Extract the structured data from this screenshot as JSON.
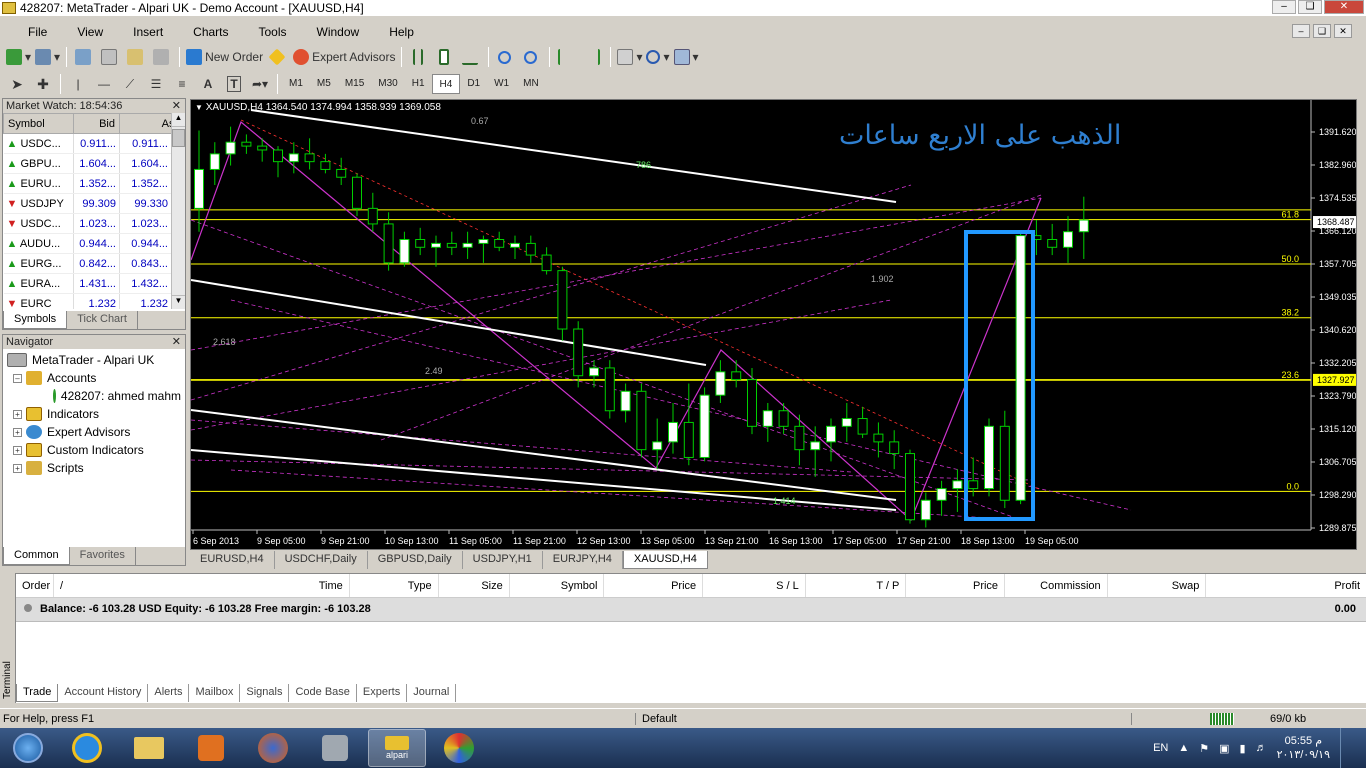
{
  "window": {
    "title": "428207: MetaTrader - Alpari UK - Demo Account - [XAUUSD,H4]"
  },
  "menu": [
    "File",
    "View",
    "Insert",
    "Charts",
    "Tools",
    "Window",
    "Help"
  ],
  "toolbar": {
    "new_order": "New Order",
    "expert_advisors": "Expert Advisors"
  },
  "timeframes": [
    "M1",
    "M5",
    "M15",
    "M30",
    "H1",
    "H4",
    "D1",
    "W1",
    "MN"
  ],
  "active_timeframe": "H4",
  "market_watch": {
    "title": "Market Watch: 18:54:36",
    "columns": [
      "Symbol",
      "Bid",
      "Ask"
    ],
    "rows": [
      {
        "symbol": "USDC...",
        "bid": "0.911...",
        "ask": "0.911...",
        "dir": "up"
      },
      {
        "symbol": "GBPU...",
        "bid": "1.604...",
        "ask": "1.604...",
        "dir": "up"
      },
      {
        "symbol": "EURU...",
        "bid": "1.352...",
        "ask": "1.352...",
        "dir": "up"
      },
      {
        "symbol": "USDJPY",
        "bid": "99.309",
        "ask": "99.330",
        "dir": "down"
      },
      {
        "symbol": "USDC...",
        "bid": "1.023...",
        "ask": "1.023...",
        "dir": "down"
      },
      {
        "symbol": "AUDU...",
        "bid": "0.944...",
        "ask": "0.944...",
        "dir": "up"
      },
      {
        "symbol": "EURG...",
        "bid": "0.842...",
        "ask": "0.843...",
        "dir": "up"
      },
      {
        "symbol": "EURA...",
        "bid": "1.431...",
        "ask": "1.432...",
        "dir": "up"
      },
      {
        "symbol": "EURC",
        "bid": "1.232",
        "ask": "1.232",
        "dir": "down"
      }
    ],
    "tabs": [
      "Symbols",
      "Tick Chart"
    ]
  },
  "navigator": {
    "title": "Navigator",
    "root": "MetaTrader - Alpari UK",
    "accounts": "Accounts",
    "account": "428207: ahmed mahm",
    "items": [
      "Indicators",
      "Expert Advisors",
      "Custom Indicators",
      "Scripts"
    ],
    "tabs": [
      "Common",
      "Favorites"
    ]
  },
  "chart": {
    "header": "XAUUSD,H4  1364.540 1374.994 1358.939 1369.058",
    "annotation": "الذهب على الاربع ساعات",
    "price_axis": [
      "1391.620",
      "1382.960",
      "1374.535",
      "1366.120",
      "1357.705",
      "1349.035",
      "1340.620",
      "1332.205",
      "1323.790",
      "1315.120",
      "1306.705",
      "1298.290",
      "1289.875"
    ],
    "current_price": "1368.487",
    "level_price": "1327.927",
    "fib_labels": [
      "61.8",
      "50.0",
      "38.2",
      "23.6",
      "0.0"
    ],
    "fan_labels": [
      "0.67",
      "786",
      "1.902",
      "2.618",
      "2.49",
      "1.414"
    ],
    "time_axis": [
      "6 Sep 2013",
      "9 Sep 05:00",
      "9 Sep 21:00",
      "10 Sep 13:00",
      "11 Sep 05:00",
      "11 Sep 21:00",
      "12 Sep 13:00",
      "13 Sep 05:00",
      "13 Sep 21:00",
      "16 Sep 13:00",
      "17 Sep 05:00",
      "17 Sep 21:00",
      "18 Sep 13:00",
      "19 Sep 05:00"
    ],
    "colors": {
      "bg": "#000000",
      "bull": "#ffffff",
      "wick": "#00d000",
      "fib": "#ffff00",
      "fan": "#cc33cc",
      "trend": "#ffffff",
      "box": "#2299ff",
      "annotation": "#2f7fd0"
    }
  },
  "chart_tabs": [
    "EURUSD,H4",
    "USDCHF,Daily",
    "GBPUSD,Daily",
    "USDJPY,H1",
    "EURJPY,H4",
    "XAUUSD,H4"
  ],
  "active_chart_tab": "XAUUSD,H4",
  "terminal": {
    "side_label": "Terminal",
    "columns": [
      "Order",
      "/",
      "Time",
      "Type",
      "Size",
      "Symbol",
      "Price",
      "S / L",
      "T / P",
      "Price",
      "Commission",
      "Swap",
      "Profit"
    ],
    "balance_line": "Balance: -6 103.28 USD  Equity: -6 103.28  Free margin: -6 103.28",
    "profit": "0.00",
    "tabs": [
      "Trade",
      "Account History",
      "Alerts",
      "Mailbox",
      "Signals",
      "Code Base",
      "Experts",
      "Journal"
    ]
  },
  "status": {
    "help": "For Help, press F1",
    "profile": "Default",
    "traffic": "69/0 kb"
  },
  "taskbar": {
    "lang": "EN",
    "time": "05:55 م",
    "date": "٢٠١٣/٠٩/١٩",
    "alpari_label": "alpari"
  }
}
